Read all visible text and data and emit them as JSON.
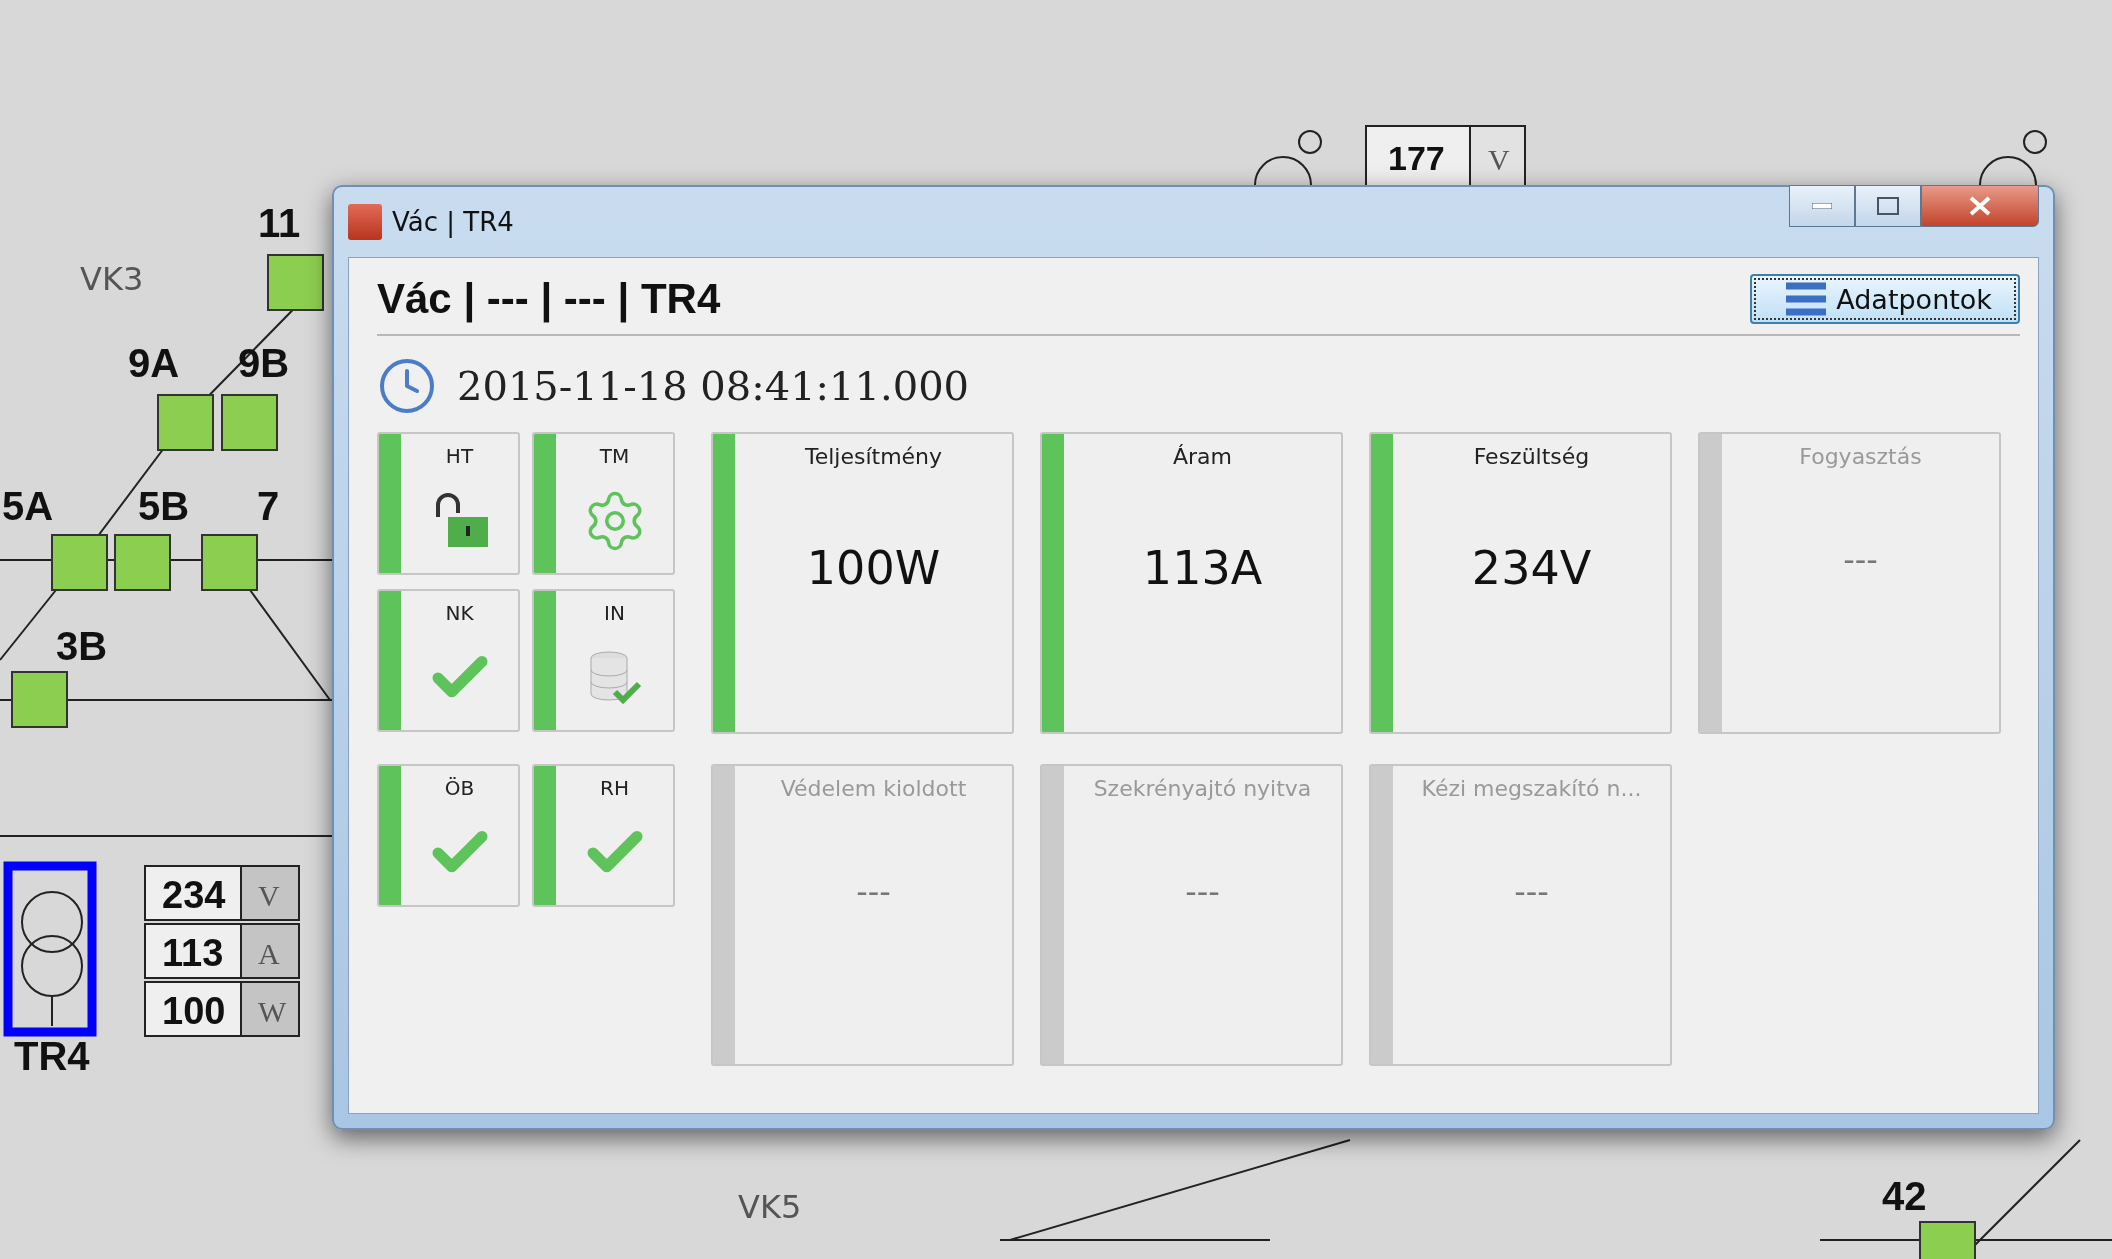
{
  "diagram": {
    "area_labels": [
      "VK3",
      "VK5"
    ],
    "switches": [
      {
        "label": "11"
      },
      {
        "label": "9A"
      },
      {
        "label": "9B"
      },
      {
        "label": "5A"
      },
      {
        "label": "5B"
      },
      {
        "label": "7"
      },
      {
        "label": "3B"
      },
      {
        "label": "42"
      }
    ],
    "transformer": {
      "label": "TR4",
      "selected": true
    },
    "meters": [
      {
        "value": "234",
        "unit": "V"
      },
      {
        "value": "113",
        "unit": "A"
      },
      {
        "value": "100",
        "unit": "W"
      }
    ],
    "top_meter": {
      "value": "177",
      "unit": "V"
    }
  },
  "window": {
    "title": "Vác | TR4",
    "heading": "Vác | --- | --- | TR4",
    "button": "Adatpontok",
    "timestamp": "2015-11-18 08:41:11.000",
    "status_tiles": [
      {
        "label": "HT",
        "kind": "lock",
        "active": true
      },
      {
        "label": "TM",
        "kind": "gear",
        "active": true
      },
      {
        "label": "NK",
        "kind": "check",
        "active": true
      },
      {
        "label": "IN",
        "kind": "database",
        "active": true
      },
      {
        "label": "ÖB",
        "kind": "check",
        "active": true
      },
      {
        "label": "RH",
        "kind": "check",
        "active": true
      }
    ],
    "measure_tiles": [
      {
        "label": "Teljesítmény",
        "value": "100W",
        "active": true
      },
      {
        "label": "Áram",
        "value": "113A",
        "active": true
      },
      {
        "label": "Feszültség",
        "value": "234V",
        "active": true
      },
      {
        "label": "Fogyasztás",
        "value": "---",
        "active": false
      },
      {
        "label": "Védelem kioldott",
        "value": "---",
        "active": false
      },
      {
        "label": "Szekrényajtó nyitva",
        "value": "---",
        "active": false
      },
      {
        "label": "Kézi megszakító n...",
        "value": "---",
        "active": false
      }
    ]
  }
}
